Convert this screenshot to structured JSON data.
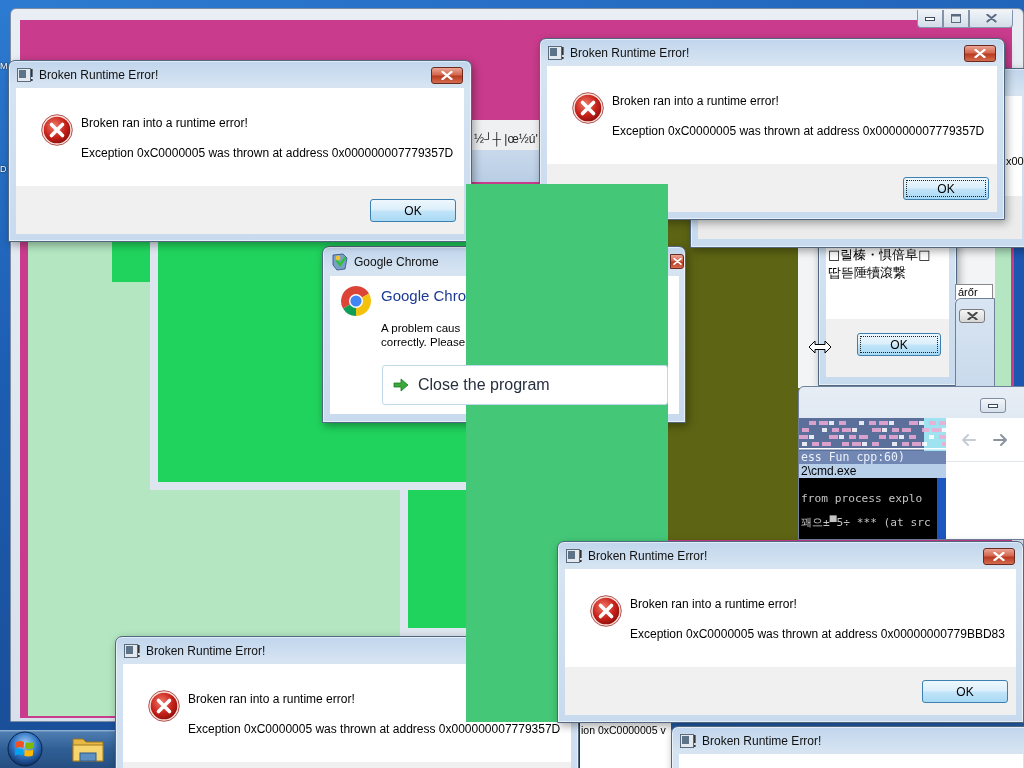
{
  "desktop": {
    "icon_labels": [
      "M",
      "D"
    ]
  },
  "glitched_window": {
    "text": "½┘┼ |œ½ú'"
  },
  "back_dialog": {
    "text": "x00"
  },
  "error_dialogs": [
    {
      "title": "Broken Runtime Error!",
      "message": "Broken ran into a runtime error!",
      "detail": "Exception 0xC0000005 was thrown at address 0x000000007779357D",
      "ok_button": {
        "label": "OK",
        "focused": false
      }
    },
    {
      "title": "Broken Runtime Error!",
      "message": "Broken ran into a runtime error!",
      "detail": "Exception 0xC0000005 was thrown at address 0x000000007779357D",
      "ok_button": {
        "label": "OK",
        "focused": true
      }
    },
    {
      "title": "Broken Runtime Error!",
      "message": "Broken ran into a runtime error!",
      "detail": "Exception 0xC0000005 was thrown at address 0x00000000779BBD83",
      "ok_button": {
        "label": "OK",
        "focused": false
      }
    },
    {
      "title": "Broken Runtime Error!",
      "message": "Broken ran into a runtime error!",
      "detail": "Exception 0xC0000005 was thrown at address 0x000000007779357D"
    },
    {
      "title": "Broken Runtime Error!"
    }
  ],
  "garbled_dialog": {
    "lines": [
      "□릴榛・惧倍阜□",
      "땁뜯陲犢滾繋"
    ],
    "ok_button": {
      "label": "OK",
      "focused": true
    }
  },
  "tab_fragment": {
    "label": "árőr"
  },
  "console_window": {
    "glitch_line": "ess Fun cpp:60)",
    "title": "2\\cmd.exe",
    "lines": [
      "from process explo",
      "꽤으±▀5÷ *** (at src"
    ]
  },
  "chrome_dialog": {
    "title": "Google Chrome",
    "heading": "Google Chro",
    "message_lines": [
      "A problem caus",
      "correctly. Please"
    ],
    "command_link": "Close the program"
  },
  "text_fragment": {
    "text": "ion 0xC0000005 v"
  }
}
